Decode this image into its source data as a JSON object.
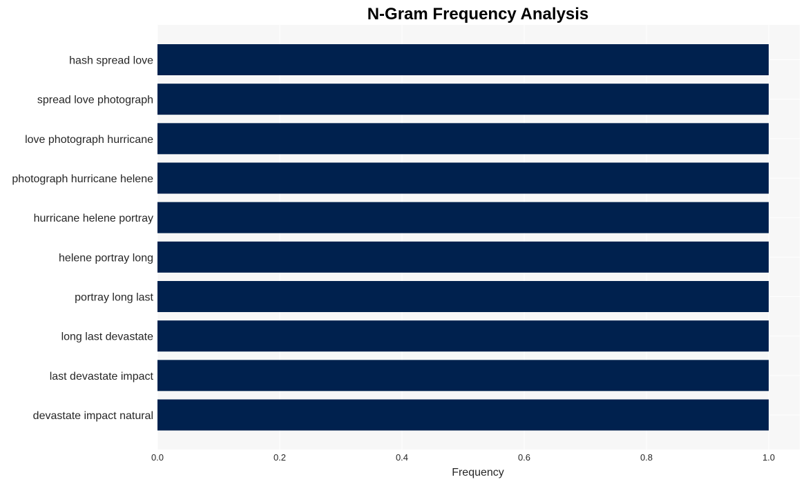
{
  "chart_data": {
    "type": "bar",
    "orientation": "horizontal",
    "title": "N-Gram Frequency Analysis",
    "xlabel": "Frequency",
    "ylabel": "",
    "categories": [
      "hash spread love",
      "spread love photograph",
      "love photograph hurricane",
      "photograph hurricane helene",
      "hurricane helene portray",
      "helene portray long",
      "portray long last",
      "long last devastate",
      "last devastate impact",
      "devastate impact natural"
    ],
    "values": [
      1,
      1,
      1,
      1,
      1,
      1,
      1,
      1,
      1,
      1
    ],
    "xlim": [
      0,
      1.05
    ],
    "xticks": [
      0.0,
      0.2,
      0.4,
      0.6,
      0.8,
      1.0
    ],
    "xtick_labels": [
      "0.0",
      "0.2",
      "0.4",
      "0.6",
      "0.8",
      "1.0"
    ],
    "grid": true,
    "bar_color": "#00214e",
    "background_color": "#f7f7f7",
    "grid_color": "#ffffff"
  }
}
